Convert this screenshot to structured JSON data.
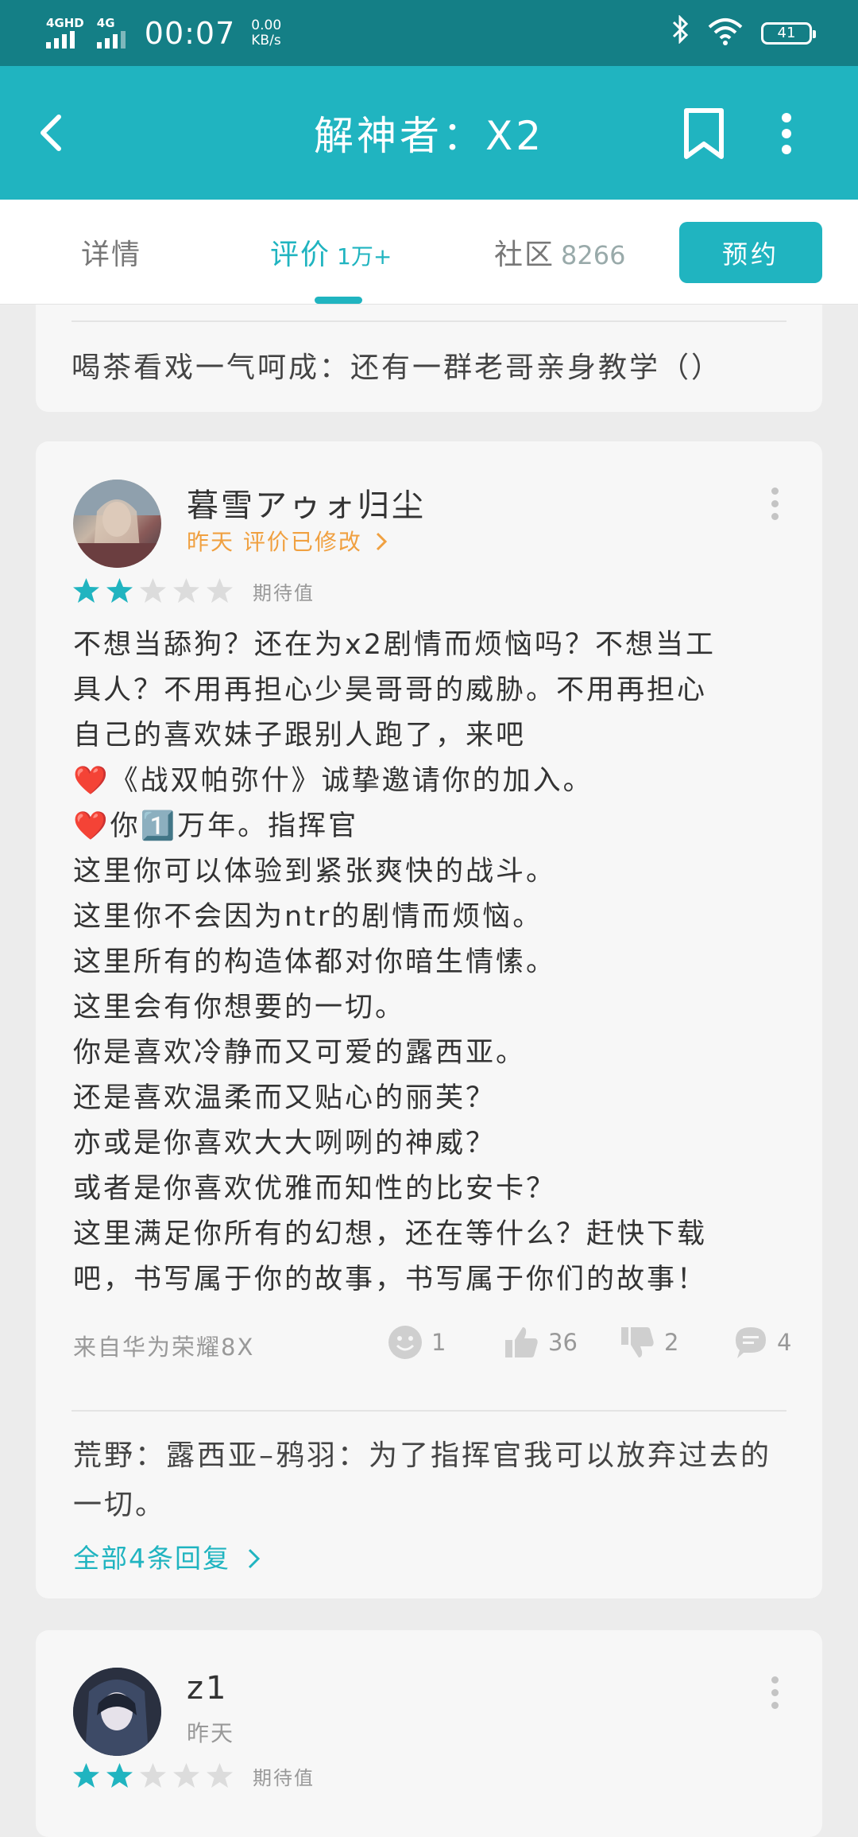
{
  "status_bar": {
    "signal1_label": "4GHD",
    "signal2_label": "4G",
    "time": "00:07",
    "speed_value": "0.00",
    "speed_unit": "KB/s",
    "battery": "41"
  },
  "app_bar": {
    "title": "解神者：X2",
    "icons": [
      "back-arrow-icon",
      "bookmark-icon",
      "more-vertical-icon"
    ]
  },
  "tabs": [
    {
      "label": "详情",
      "count": ""
    },
    {
      "label": "评价",
      "count": "1万+"
    },
    {
      "label": "社区",
      "count": "8266"
    }
  ],
  "reserve_button": "预约",
  "prev_card": {
    "reply_text": "喝茶看戏一气呵成：还有一群老哥亲身教学（）"
  },
  "review1": {
    "username": "暮雪アゥォ归尘",
    "sub": "昨天 评价已修改",
    "rating": 2,
    "max_rating": 5,
    "rating_label": "期待值",
    "body_lines": [
      "不想当舔狗？还在为x2剧情而烦恼吗？不想当工",
      "具人？不用再担心少昊哥哥的威胁。不用再担心",
      "自己的喜欢妹子跟别人跑了，来吧",
      "❤️《战双帕弥什》诚挚邀请你的加入。",
      "❤️你1️⃣万年。指挥官",
      "这里你可以体验到紧张爽快的战斗。",
      "这里你不会因为ntr的剧情而烦恼。",
      "这里所有的构造体都对你暗生情愫。",
      "这里会有你想要的一切。",
      "你是喜欢冷静而又可爱的露西亚。",
      "还是喜欢温柔而又贴心的丽芙？",
      "亦或是你喜欢大大咧咧的神威？",
      "或者是你喜欢优雅而知性的比安卡？",
      "这里满足你所有的幻想，还在等什么？赶快下载",
      "吧，书写属于你的故事，书写属于你们的故事！"
    ],
    "device": "来自华为荣耀8X",
    "actions": {
      "smile": "1",
      "like": "36",
      "dislike": "2",
      "comment": "4"
    },
    "reply_preview": "荒野：露西亚–鸦羽：为了指挥官我可以放弃过去的一切。",
    "all_replies": "全部4条回复"
  },
  "review2": {
    "username": "z1",
    "sub": "昨天",
    "rating": 2,
    "max_rating": 5,
    "rating_label": "期待值"
  },
  "colors": {
    "status_bar": "#147f86",
    "accent": "#20b4c0",
    "orange": "#f0a040",
    "card_bg": "#f7f7f7"
  }
}
